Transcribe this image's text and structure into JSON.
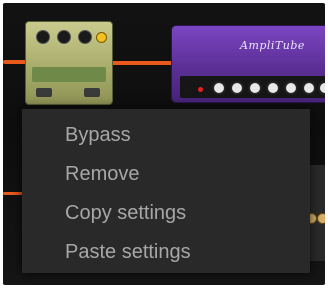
{
  "amp": {
    "brand_logo": "AmpliTube"
  },
  "context_menu": {
    "items": [
      {
        "label": "Bypass"
      },
      {
        "label": "Remove"
      },
      {
        "label": "Copy settings"
      },
      {
        "label": "Paste settings"
      }
    ]
  },
  "colors": {
    "cable": "#e85a1c",
    "amp_body": "#6a3aab",
    "menu_bg": "#292929",
    "menu_text": "#a7a7a7"
  },
  "icons": {
    "stomp": "overdrive-pedal-icon",
    "amp": "amp-head-icon"
  }
}
